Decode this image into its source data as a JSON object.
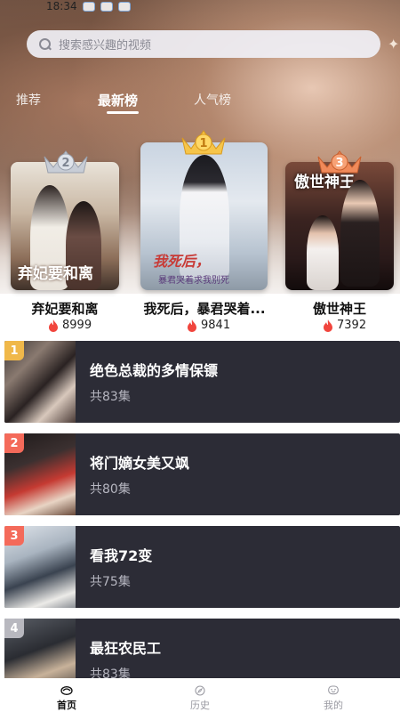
{
  "status_bar": {
    "time": "18:34"
  },
  "search": {
    "placeholder": "搜索感兴趣的视频"
  },
  "tabs": [
    {
      "label": "推荐",
      "active": false
    },
    {
      "label": "最新榜",
      "active": true
    },
    {
      "label": "人气榜",
      "active": false
    }
  ],
  "podium": [
    {
      "rank": "2",
      "title": "弃妃要和离",
      "heat": "8999",
      "poster_text": "弃妃要和离"
    },
    {
      "rank": "1",
      "title": "我死后，暴君哭着...",
      "heat": "9841",
      "poster_text": "我死后，",
      "poster_subtext": "暴君哭着求我别死"
    },
    {
      "rank": "3",
      "title": "傲世神王",
      "heat": "7392",
      "poster_text": "傲世神王"
    }
  ],
  "list": [
    {
      "rank": "1",
      "title": "绝色总裁的多情保镖",
      "episodes": "共83集"
    },
    {
      "rank": "2",
      "title": "将门嫡女美又飒",
      "episodes": "共80集"
    },
    {
      "rank": "3",
      "title": "看我72变",
      "episodes": "共75集"
    },
    {
      "rank": "4",
      "title": "最狂农民工",
      "episodes": "共83集"
    }
  ],
  "bottom_nav": [
    {
      "label": "首页",
      "icon": "home-icon",
      "active": true
    },
    {
      "label": "历史",
      "icon": "compass-icon",
      "active": false
    },
    {
      "label": "我的",
      "icon": "profile-icon",
      "active": false
    }
  ],
  "colors": {
    "list_bg": "#2c2c36",
    "rank_gold": "#f0b84a",
    "rank_red": "#f46a5a",
    "rank_gray": "#b8b8bf",
    "fire": "#f1453d"
  }
}
